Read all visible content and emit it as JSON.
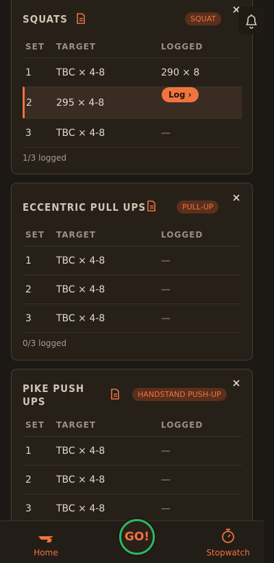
{
  "exercises": [
    {
      "name": "SQUATS",
      "badge": "SQUAT",
      "columns": [
        "SET",
        "TARGET",
        "LOGGED"
      ],
      "rows": [
        {
          "set": "1",
          "target": "TBC × 4-8",
          "logged": "290 × 8"
        },
        {
          "set": "2",
          "target": "295 × 4-8",
          "logged": "Log ›"
        },
        {
          "set": "3",
          "target": "TBC × 4-8",
          "logged": "—"
        }
      ],
      "summary": "1/3 logged"
    },
    {
      "name": "ECCENTRIC PULL UPS",
      "badge": "PULL-UP",
      "columns": [
        "SET",
        "TARGET",
        "LOGGED"
      ],
      "rows": [
        {
          "set": "1",
          "target": "TBC × 4-8",
          "logged": "—"
        },
        {
          "set": "2",
          "target": "TBC × 4-8",
          "logged": "—"
        },
        {
          "set": "3",
          "target": "TBC × 4-8",
          "logged": "—"
        }
      ],
      "summary": "0/3 logged"
    },
    {
      "name_line1": "PIKE PUSH",
      "name_line2": "UPS",
      "badge": "HANDSTAND PUSH-UP",
      "columns": [
        "SET",
        "TARGET",
        "LOGGED"
      ],
      "rows": [
        {
          "set": "1",
          "target": "TBC × 4-8",
          "logged": "—"
        },
        {
          "set": "2",
          "target": "TBC × 4-8",
          "logged": "—"
        },
        {
          "set": "3",
          "target": "TBC × 4-8",
          "logged": "—"
        }
      ]
    }
  ],
  "nav": {
    "home": "Home",
    "go": "GO!",
    "stopwatch": "Stopwatch"
  },
  "colors": {
    "accent": "#ef7440",
    "go_ring": "#2fb866",
    "card_bg": "#262019",
    "page_bg": "#1c1814"
  },
  "icons": [
    "note-icon",
    "close-icon",
    "bell-icon",
    "home-icon",
    "stopwatch-icon"
  ]
}
